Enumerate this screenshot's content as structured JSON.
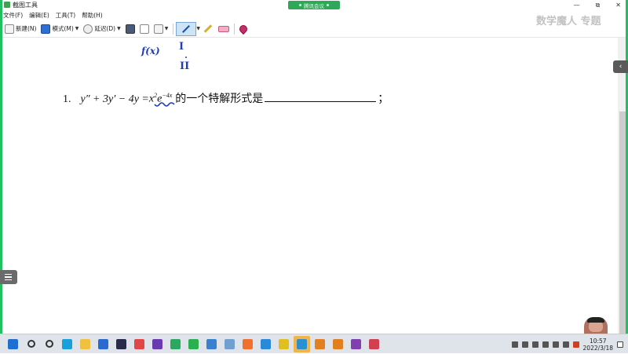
{
  "window": {
    "title": "截图工具",
    "controls": [
      "—",
      "⧉",
      "✕"
    ]
  },
  "meeting": {
    "label": "腾讯会议"
  },
  "menu": {
    "items": [
      "文件(F)",
      "编辑(E)",
      "工具(T)",
      "帮助(H)"
    ]
  },
  "toolbar": {
    "new_label": "新建(N)",
    "mode_label": "模式(M)",
    "delay_label": "延迟(D)"
  },
  "handwriting": {
    "fx": "f(x)",
    "roman1": "I",
    "roman2": "II"
  },
  "problem": {
    "number": "1.",
    "lhs": "y″ + 3y′ − 4y = ",
    "x_base": "x",
    "x_exp": "2",
    "e_base": "e",
    "e_exp": "−4x",
    "text": "的一个特解形式是",
    "end": "；"
  },
  "watermark": "数学魔人 专题",
  "taskbar": {
    "apps": [
      {
        "name": "windows-start",
        "color": "#1e6fd0"
      },
      {
        "name": "search",
        "color": "#333333"
      },
      {
        "name": "task-view",
        "color": "#333333"
      },
      {
        "name": "edge",
        "color": "#1aa0d8"
      },
      {
        "name": "file-explorer",
        "color": "#f0c040"
      },
      {
        "name": "store",
        "color": "#2a6ad0"
      },
      {
        "name": "terminal",
        "color": "#2a2a4a"
      },
      {
        "name": "red-app",
        "color": "#e04848"
      },
      {
        "name": "visual-studio",
        "color": "#6a3ab0"
      },
      {
        "name": "green-edge-app",
        "color": "#2aa860"
      },
      {
        "name": "wechat",
        "color": "#2ab050"
      },
      {
        "name": "pc-app",
        "color": "#3a80d0"
      },
      {
        "name": "paint-app",
        "color": "#70a0d0"
      },
      {
        "name": "orange-app",
        "color": "#f07030"
      },
      {
        "name": "cloud-app",
        "color": "#2a8ad8"
      },
      {
        "name": "yellow-app",
        "color": "#e0c020"
      },
      {
        "name": "pen-app",
        "color": "#2a90d0"
      },
      {
        "name": "help-app",
        "color": "#e08020"
      },
      {
        "name": "help-app-2",
        "color": "#e08020"
      },
      {
        "name": "onenote",
        "color": "#8040b0"
      },
      {
        "name": "snipping",
        "color": "#d04050"
      }
    ],
    "clock_time": "10:57",
    "clock_date": "2022/3/18"
  }
}
